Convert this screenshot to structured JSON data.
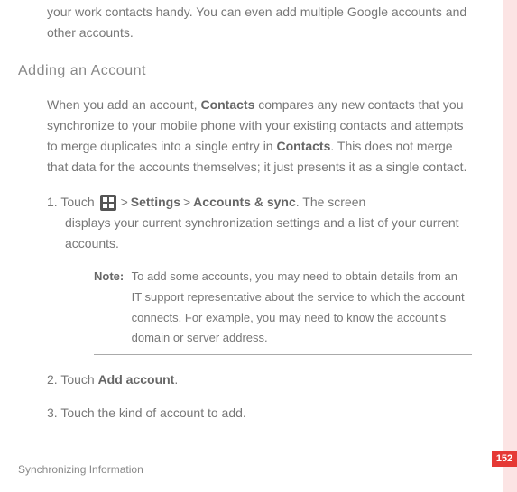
{
  "intro": "your work contacts handy. You can even add multiple Google accounts and other accounts.",
  "heading": "Adding an Account",
  "body_part1": "When you add an account, ",
  "body_bold1": "Contacts",
  "body_part2": " compares any new contacts that you synchronize to your mobile phone with your existing contacts and attempts to merge duplicates into a single entry in ",
  "body_bold2": "Contacts",
  "body_part3": ". This does not merge that data for the accounts themselves; it just presents it as a single contact.",
  "step1_prefix": "1. Touch ",
  "step1_gt": ">",
  "step1_settings": "Settings",
  "step1_accounts": "Accounts & sync",
  "step1_suffix": ". The screen",
  "step1_line2": "displays your current synchronization settings and a list of your current accounts.",
  "note_label": "Note:",
  "note_text": "To add some accounts, you may need to obtain details from an IT support representative about the service to which the account connects. For example, you may need to know the account's domain or server address.",
  "step2_prefix": "2. Touch ",
  "step2_bold": "Add account",
  "step2_suffix": ".",
  "step3": "3. Touch the kind of account to add.",
  "footer": "Synchronizing Information",
  "page_number": "152"
}
